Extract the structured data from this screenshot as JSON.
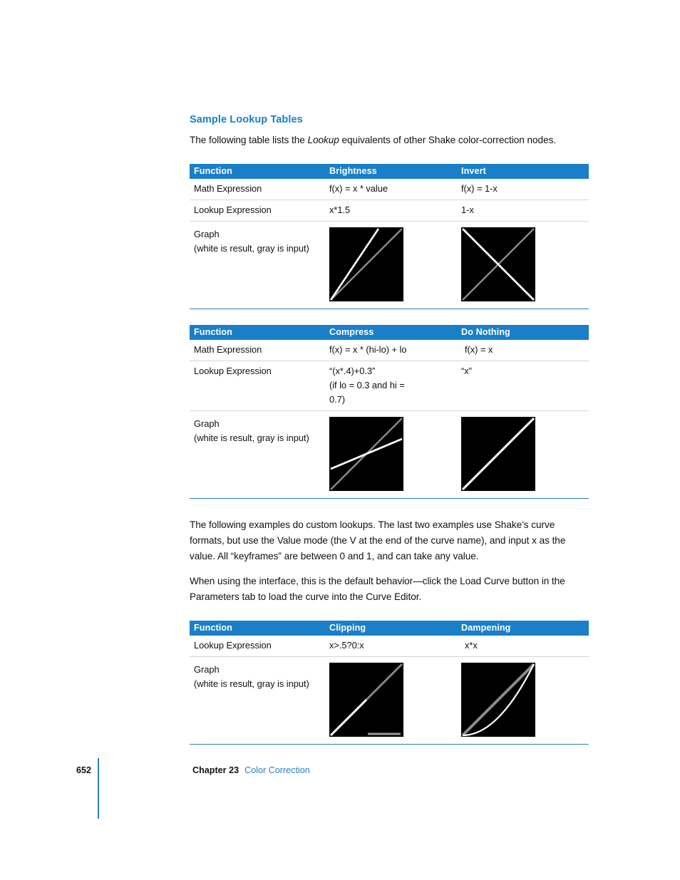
{
  "section": {
    "heading": "Sample Lookup Tables",
    "intro_before": "The following table lists the ",
    "intro_italic": "Lookup",
    "intro_after": " equivalents of other Shake color-correction nodes."
  },
  "paragraphs": {
    "p1": "The following examples do custom lookups. The last two examples use Shake’s curve formats, but use the Value mode (the V at the end of the curve name), and input x as the value. All “keyframes” are between 0 and 1, and can take any value.",
    "p2": "When using the interface, this is the default behavior—click the Load Curve button in the Parameters tab to load the curve into the Curve Editor."
  },
  "labels": {
    "function": "Function",
    "math_expression": "Math Expression",
    "lookup_expression": "Lookup Expression",
    "graph": "Graph",
    "graph_note": "(white is result, gray is input)"
  },
  "tables": [
    {
      "name": "table-brightness-invert",
      "headers": [
        "Function",
        "Brightness",
        "Invert"
      ],
      "rows": [
        {
          "label": "Math Expression",
          "a": "f(x) = x * value",
          "b": "f(x) = 1-x"
        },
        {
          "label": "Lookup Expression",
          "a": "x*1.5",
          "b": "1-x"
        }
      ],
      "graphs": {
        "a": "brightness-graph",
        "b": "invert-graph"
      }
    },
    {
      "name": "table-compress-donothing",
      "headers": [
        "Function",
        "Compress",
        "Do Nothing"
      ],
      "rows": [
        {
          "label": "Math Expression",
          "a": "f(x) = x * (hi-lo) + lo",
          "b": "f(x) = x"
        },
        {
          "label": "Lookup Expression",
          "a": "“(x*.4)+0.3”",
          "a2": "(if lo = 0.3 and hi =",
          "a3": "0.7)",
          "b": "“x”"
        }
      ],
      "graphs": {
        "a": "compress-graph",
        "b": "do-nothing-graph"
      }
    },
    {
      "name": "table-clipping-dampening",
      "headers": [
        "Function",
        "Clipping",
        "Dampening"
      ],
      "rows": [
        {
          "label": "Lookup Expression",
          "a": "x>.5?0:x",
          "b": "x*x"
        }
      ],
      "graphs": {
        "a": "clipping-graph",
        "b": "dampening-graph"
      }
    }
  ],
  "chart_data": [
    {
      "type": "line",
      "name": "brightness-graph",
      "title": "Brightness",
      "xlim": [
        0,
        1
      ],
      "ylim": [
        0,
        1
      ],
      "grid": false,
      "legend": "none",
      "series": [
        {
          "name": "input (gray)",
          "color": "#8a8a8a",
          "x": [
            0,
            1
          ],
          "y": [
            0,
            1
          ]
        },
        {
          "name": "result (white) x*1.5",
          "color": "#ffffff",
          "x": [
            0,
            0.667
          ],
          "y": [
            0,
            1
          ]
        }
      ]
    },
    {
      "type": "line",
      "name": "invert-graph",
      "title": "Invert",
      "xlim": [
        0,
        1
      ],
      "ylim": [
        0,
        1
      ],
      "grid": false,
      "legend": "none",
      "series": [
        {
          "name": "input (gray)",
          "color": "#8a8a8a",
          "x": [
            0,
            1
          ],
          "y": [
            0,
            1
          ]
        },
        {
          "name": "result (white) 1-x",
          "color": "#ffffff",
          "x": [
            0,
            1
          ],
          "y": [
            1,
            0
          ]
        }
      ]
    },
    {
      "type": "line",
      "name": "compress-graph",
      "title": "Compress",
      "xlim": [
        0,
        1
      ],
      "ylim": [
        0,
        1
      ],
      "grid": false,
      "legend": "none",
      "series": [
        {
          "name": "input (gray)",
          "color": "#8a8a8a",
          "x": [
            0,
            1
          ],
          "y": [
            0,
            1
          ]
        },
        {
          "name": "result (white) (x*.4)+0.3",
          "color": "#ffffff",
          "x": [
            0,
            1
          ],
          "y": [
            0.3,
            0.7
          ]
        }
      ]
    },
    {
      "type": "line",
      "name": "do-nothing-graph",
      "title": "Do Nothing",
      "xlim": [
        0,
        1
      ],
      "ylim": [
        0,
        1
      ],
      "grid": false,
      "legend": "none",
      "series": [
        {
          "name": "input (gray)",
          "color": "#8a8a8a",
          "x": [
            0,
            1
          ],
          "y": [
            0,
            1
          ]
        },
        {
          "name": "result (white) x",
          "color": "#ffffff",
          "x": [
            0,
            1
          ],
          "y": [
            0,
            1
          ]
        }
      ]
    },
    {
      "type": "line",
      "name": "clipping-graph",
      "title": "Clipping",
      "xlim": [
        0,
        1
      ],
      "ylim": [
        0,
        1
      ],
      "grid": false,
      "legend": "none",
      "series": [
        {
          "name": "input (gray)",
          "color": "#8a8a8a",
          "x": [
            0,
            1
          ],
          "y": [
            0,
            1
          ]
        },
        {
          "name": "result (white) x>.5?0:x",
          "color": "#ffffff",
          "x": [
            0,
            0.5,
            0.5,
            1
          ],
          "y": [
            0,
            0.5,
            0,
            0
          ]
        }
      ]
    },
    {
      "type": "line",
      "name": "dampening-graph",
      "title": "Dampening",
      "xlim": [
        0,
        1
      ],
      "ylim": [
        0,
        1
      ],
      "grid": false,
      "legend": "none",
      "series": [
        {
          "name": "input (gray)",
          "color": "#8a8a8a",
          "x": [
            0,
            1
          ],
          "y": [
            0,
            1
          ]
        },
        {
          "name": "result (white) x*x",
          "color": "#ffffff",
          "x": [
            0,
            0.2,
            0.4,
            0.6,
            0.8,
            1
          ],
          "y": [
            0,
            0.04,
            0.16,
            0.36,
            0.64,
            1
          ]
        }
      ]
    }
  ],
  "footer": {
    "page_number": "652",
    "chapter": "Chapter 23",
    "topic": "Color Correction"
  },
  "colors": {
    "accent_blue": "#1a7fc9",
    "rule_blue": "#2a7fc0",
    "graph_bg": "#000000",
    "graph_result": "#ffffff",
    "graph_input": "#8a8a8a"
  }
}
